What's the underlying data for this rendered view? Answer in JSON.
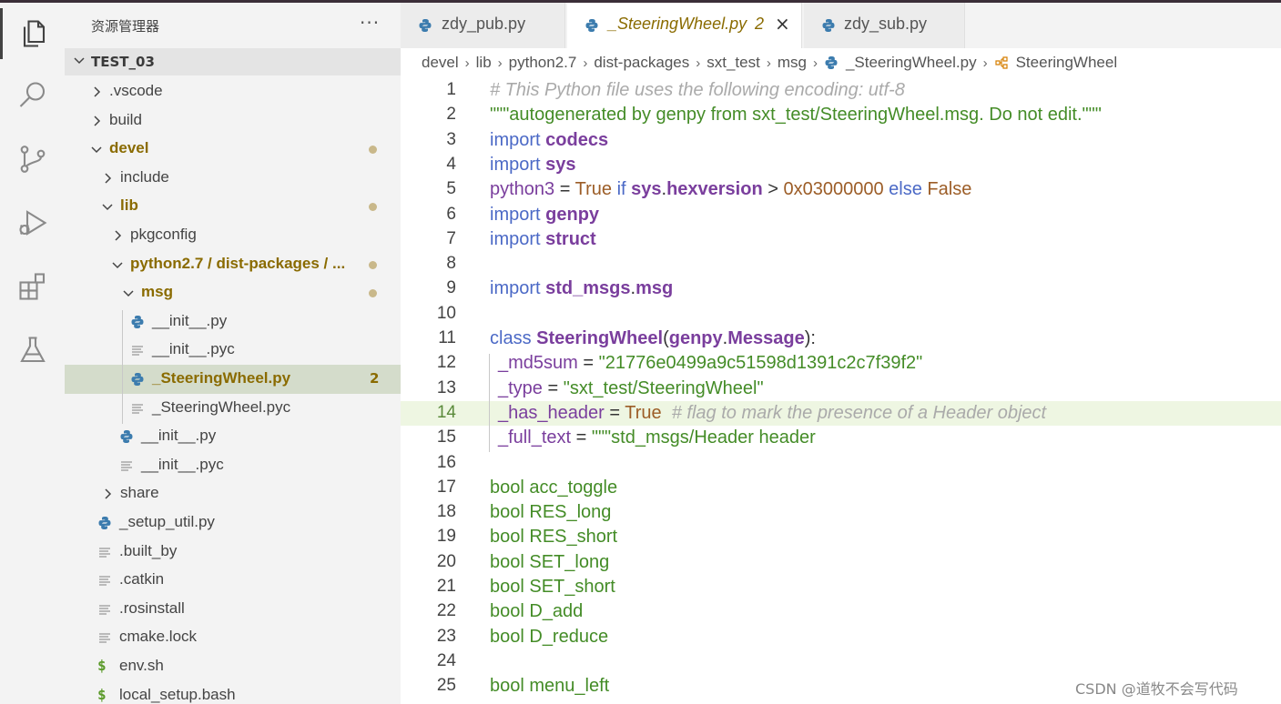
{
  "sidebar": {
    "title": "资源管理器",
    "more": "···",
    "root": "TEST_03",
    "items": [
      {
        "label": ".vscode",
        "kind": "folder",
        "state": "collapsed"
      },
      {
        "label": "build",
        "kind": "folder",
        "state": "collapsed"
      },
      {
        "label": "devel",
        "kind": "folder",
        "state": "expanded",
        "modified": true
      },
      {
        "label": "include",
        "kind": "folder",
        "state": "collapsed"
      },
      {
        "label": "lib",
        "kind": "folder",
        "state": "expanded",
        "modified": true
      },
      {
        "label": "pkgconfig",
        "kind": "folder",
        "state": "collapsed"
      },
      {
        "label": "python2.7 / dist-packages / ...",
        "kind": "folder",
        "state": "expanded",
        "modified": true
      },
      {
        "label": "msg",
        "kind": "folder",
        "state": "expanded",
        "modified": true
      },
      {
        "label": "__init__.py",
        "kind": "python"
      },
      {
        "label": "__init__.pyc",
        "kind": "text"
      },
      {
        "label": "_SteeringWheel.py",
        "kind": "python",
        "selected": true,
        "badge": "2"
      },
      {
        "label": "_SteeringWheel.pyc",
        "kind": "text"
      },
      {
        "label": "__init__.py",
        "kind": "python"
      },
      {
        "label": "__init__.pyc",
        "kind": "text"
      },
      {
        "label": "share",
        "kind": "folder",
        "state": "collapsed"
      },
      {
        "label": "_setup_util.py",
        "kind": "python"
      },
      {
        "label": ".built_by",
        "kind": "text"
      },
      {
        "label": ".catkin",
        "kind": "text"
      },
      {
        "label": ".rosinstall",
        "kind": "text"
      },
      {
        "label": "cmake.lock",
        "kind": "text"
      },
      {
        "label": "env.sh",
        "kind": "shell"
      },
      {
        "label": "local_setup.bash",
        "kind": "shell"
      }
    ]
  },
  "tabs": [
    {
      "label": "zdy_pub.py",
      "active": false
    },
    {
      "label": "_SteeringWheel.py",
      "active": true,
      "badge": "2",
      "close": "×"
    },
    {
      "label": "zdy_sub.py",
      "active": false
    }
  ],
  "breadcrumbs": [
    "devel",
    "lib",
    "python2.7",
    "dist-packages",
    "sxt_test",
    "msg",
    "_SteeringWheel.py",
    "SteeringWheel"
  ],
  "breadcrumb_sep": "›",
  "editor": {
    "current_line": 14,
    "lines": [
      {
        "n": "1",
        "t": "# This Python file uses the following encoding: utf-8"
      },
      {
        "n": "2",
        "t": "\"\"\"autogenerated by genpy from sxt_test/SteeringWheel.msg. Do not edit.\"\"\""
      },
      {
        "n": "3",
        "t": "import codecs"
      },
      {
        "n": "4",
        "t": "import sys"
      },
      {
        "n": "5",
        "t": "python3 = True if sys.hexversion > 0x03000000 else False"
      },
      {
        "n": "6",
        "t": "import genpy"
      },
      {
        "n": "7",
        "t": "import struct"
      },
      {
        "n": "8",
        "t": ""
      },
      {
        "n": "9",
        "t": "import std_msgs.msg"
      },
      {
        "n": "10",
        "t": ""
      },
      {
        "n": "11",
        "t": "class SteeringWheel(genpy.Message):"
      },
      {
        "n": "12",
        "t": "_md5sum = \"21776e0499a9c51598d1391c2c7f39f2\""
      },
      {
        "n": "13",
        "t": "_type = \"sxt_test/SteeringWheel\""
      },
      {
        "n": "14",
        "t": "_has_header = True  # flag to mark the presence of a Header object"
      },
      {
        "n": "15",
        "t": "_full_text = \"\"\"std_msgs/Header header"
      },
      {
        "n": "16",
        "t": ""
      },
      {
        "n": "17",
        "t": "bool acc_toggle"
      },
      {
        "n": "18",
        "t": "bool RES_long"
      },
      {
        "n": "19",
        "t": "bool RES_short"
      },
      {
        "n": "20",
        "t": "bool SET_long"
      },
      {
        "n": "21",
        "t": "bool SET_short"
      },
      {
        "n": "22",
        "t": "bool D_add"
      },
      {
        "n": "23",
        "t": "bool D_reduce"
      },
      {
        "n": "24",
        "t": ""
      },
      {
        "n": "25",
        "t": "bool menu_left"
      }
    ]
  },
  "watermark": "CSDN @道牧不会写代码",
  "colors": {
    "keyword": "#4b69c6",
    "module": "#7a3e9d",
    "string": "#448c27",
    "number": "#9c5d27",
    "comment": "#aaaaaa",
    "modified": "#8a6b00",
    "selection": "#d4dccb"
  },
  "icons": [
    "explorer-icon",
    "search-icon",
    "source-control-icon",
    "run-debug-icon",
    "extensions-icon",
    "testing-icon",
    "python-file-icon",
    "text-file-icon",
    "shell-file-icon",
    "symbol-class-icon"
  ]
}
